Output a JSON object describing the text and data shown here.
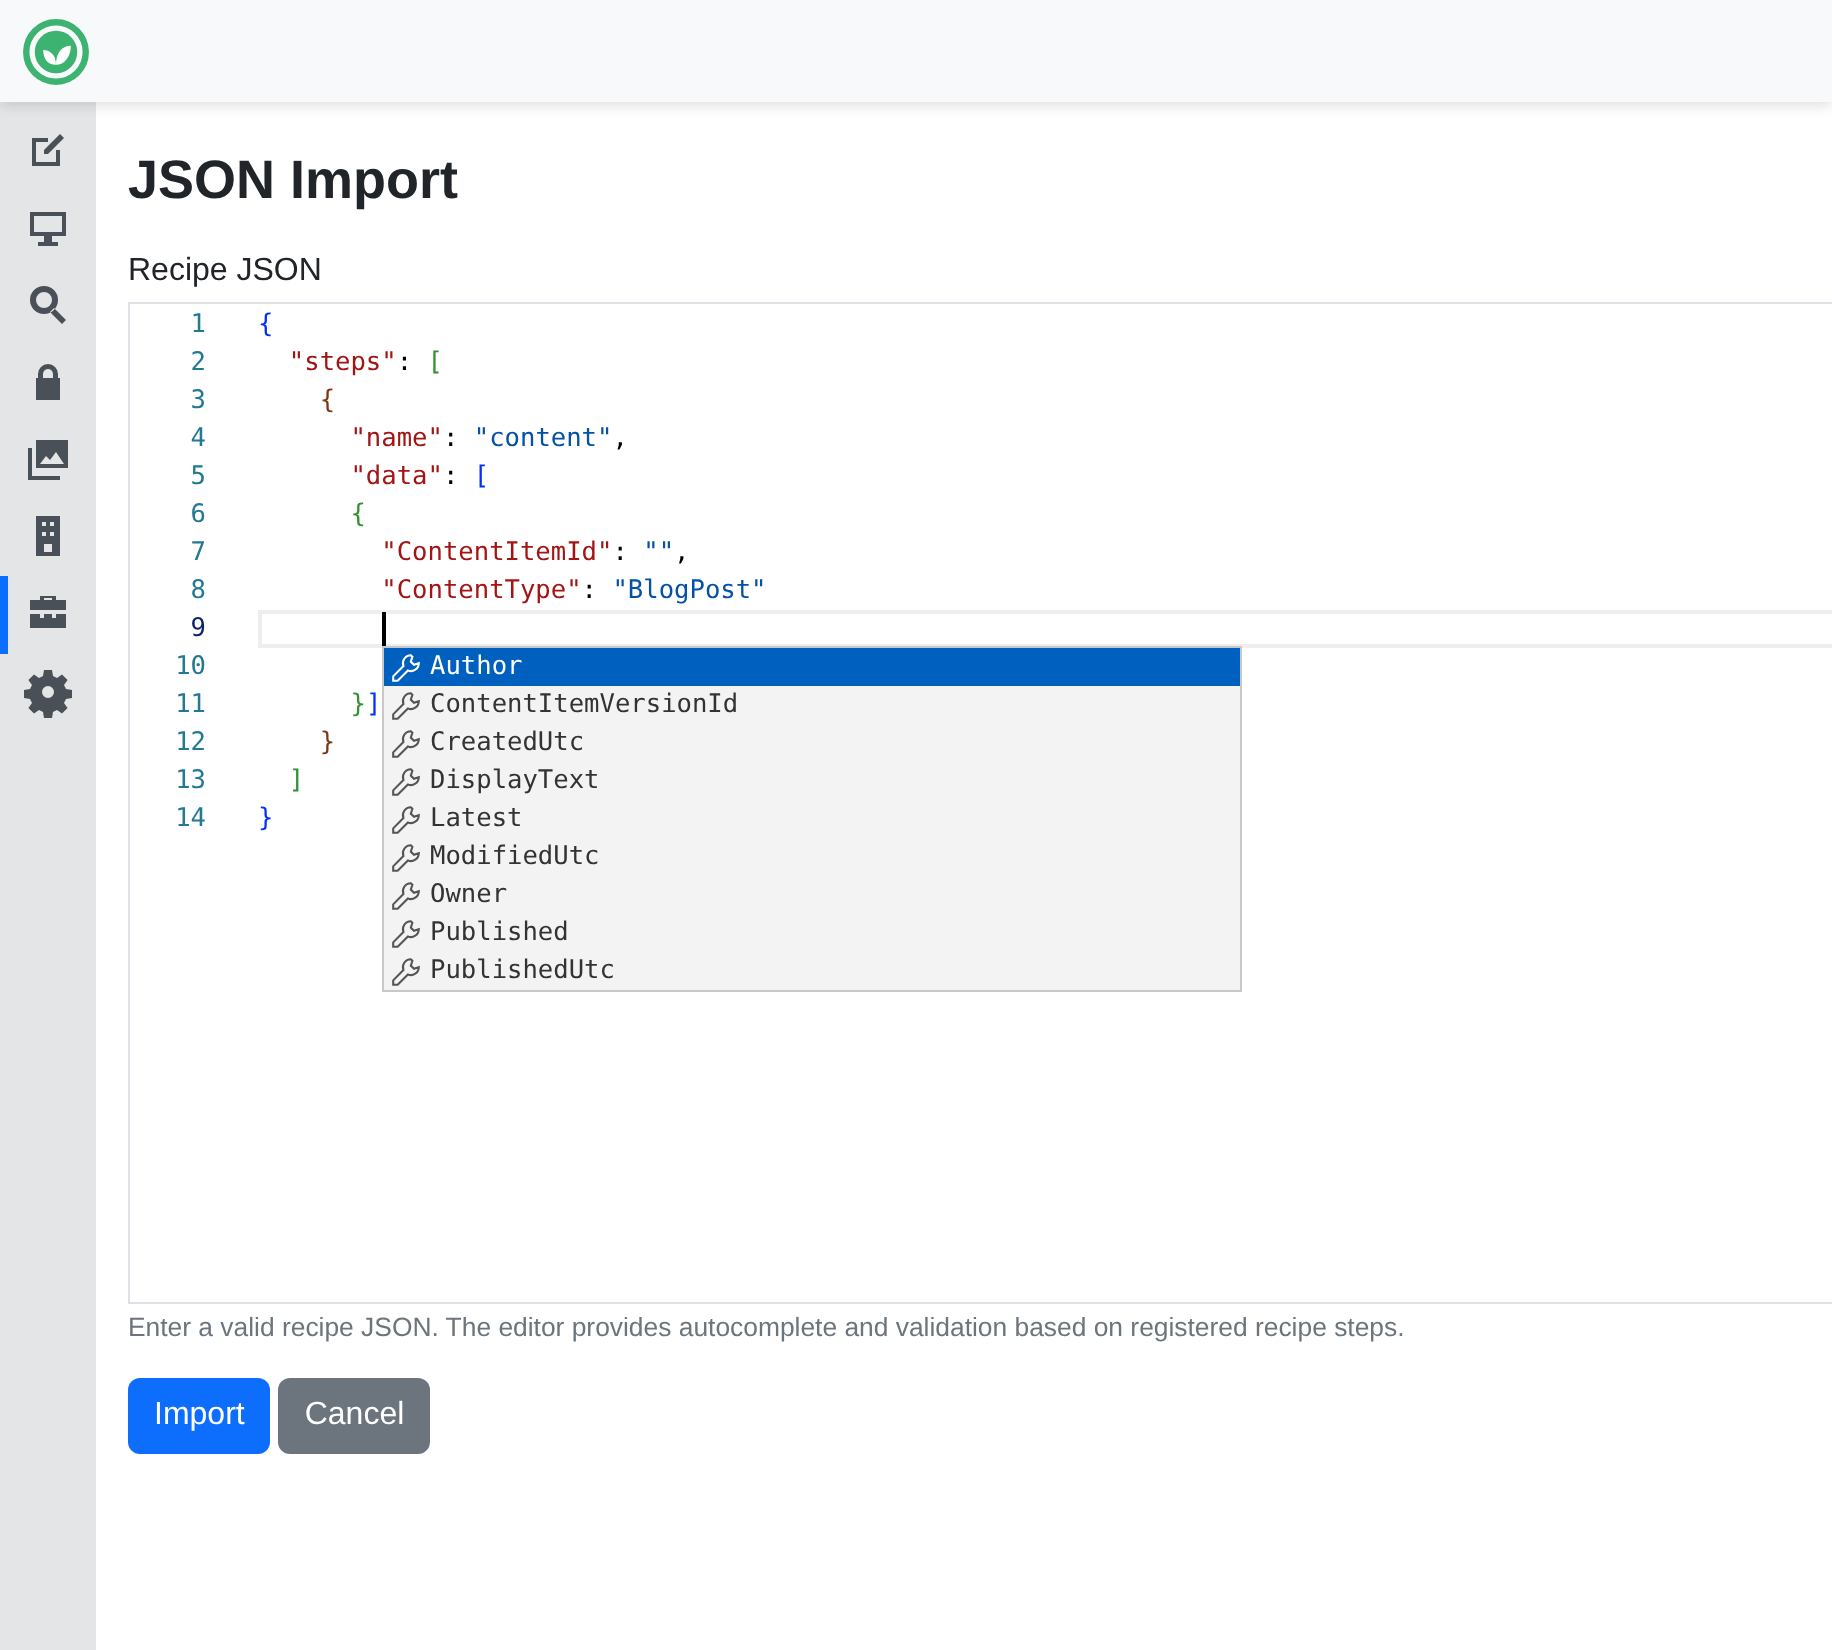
{
  "sidebar": {
    "items": [
      {
        "selected": false
      },
      {
        "selected": false
      },
      {
        "selected": false
      },
      {
        "selected": false
      },
      {
        "selected": false
      },
      {
        "selected": false
      },
      {
        "selected": true
      },
      {
        "selected": false
      }
    ]
  },
  "page": {
    "title": "JSON Import",
    "field_label": "Recipe JSON",
    "help_text": "Enter a valid recipe JSON. The editor provides autocomplete and validation based on registered recipe steps."
  },
  "editor": {
    "lines": [
      {
        "number": "1",
        "current": false,
        "tokens": [
          {
            "kind": "bracket",
            "text": "{",
            "color": "#0431fa"
          }
        ]
      },
      {
        "number": "2",
        "current": false,
        "tokens": [
          {
            "kind": "key",
            "text": "  \"steps\""
          },
          {
            "kind": "punct",
            "text": ": "
          },
          {
            "kind": "bracket",
            "text": "[",
            "color": "#319331"
          }
        ]
      },
      {
        "number": "3",
        "current": false,
        "tokens": [
          {
            "kind": "bracket",
            "text": "    {",
            "color": "#7b3814"
          }
        ]
      },
      {
        "number": "4",
        "current": false,
        "tokens": [
          {
            "kind": "key",
            "text": "      \"name\""
          },
          {
            "kind": "punct",
            "text": ": "
          },
          {
            "kind": "string",
            "text": "\"content\""
          },
          {
            "kind": "punct",
            "text": ","
          }
        ]
      },
      {
        "number": "5",
        "current": false,
        "tokens": [
          {
            "kind": "key",
            "text": "      \"data\""
          },
          {
            "kind": "punct",
            "text": ": "
          },
          {
            "kind": "bracket",
            "text": "[",
            "color": "#0431fa"
          }
        ]
      },
      {
        "number": "6",
        "current": false,
        "tokens": [
          {
            "kind": "bracket",
            "text": "      {",
            "color": "#319331"
          }
        ]
      },
      {
        "number": "7",
        "current": false,
        "tokens": [
          {
            "kind": "key",
            "text": "        \"ContentItemId\""
          },
          {
            "kind": "punct",
            "text": ": "
          },
          {
            "kind": "string",
            "text": "\"\""
          },
          {
            "kind": "punct",
            "text": ","
          }
        ]
      },
      {
        "number": "8",
        "current": false,
        "tokens": [
          {
            "kind": "key",
            "text": "        \"ContentType\""
          },
          {
            "kind": "punct",
            "text": ": "
          },
          {
            "kind": "string",
            "text": "\"BlogPost\""
          }
        ]
      },
      {
        "number": "9",
        "current": true
      },
      {
        "number": "10",
        "current": false
      },
      {
        "number": "11",
        "current": false,
        "tokens": [
          {
            "kind": "bracket",
            "text": "      }",
            "color": "#319331"
          },
          {
            "kind": "bracket",
            "text": "]",
            "color": "#0431fa"
          }
        ]
      },
      {
        "number": "12",
        "current": false,
        "tokens": [
          {
            "kind": "bracket",
            "text": "    }",
            "color": "#7b3814"
          }
        ]
      },
      {
        "number": "13",
        "current": false,
        "tokens": [
          {
            "kind": "bracket",
            "text": "  ]",
            "color": "#319331"
          }
        ]
      },
      {
        "number": "14",
        "current": false,
        "tokens": [
          {
            "kind": "bracket",
            "text": "}",
            "color": "#0431fa"
          }
        ]
      }
    ],
    "suggestions": [
      {
        "label": "Author",
        "selected": true
      },
      {
        "label": "ContentItemVersionId",
        "selected": false
      },
      {
        "label": "CreatedUtc",
        "selected": false
      },
      {
        "label": "DisplayText",
        "selected": false
      },
      {
        "label": "Latest",
        "selected": false
      },
      {
        "label": "ModifiedUtc",
        "selected": false
      },
      {
        "label": "Owner",
        "selected": false
      },
      {
        "label": "Published",
        "selected": false
      },
      {
        "label": "PublishedUtc",
        "selected": false
      }
    ]
  },
  "buttons": [
    {
      "label": "Import",
      "kind": "primary"
    },
    {
      "label": "Cancel",
      "kind": "secondary"
    }
  ]
}
